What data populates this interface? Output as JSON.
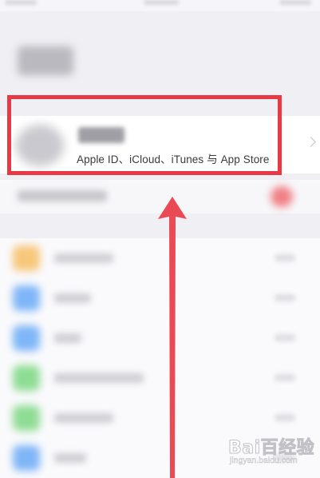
{
  "profile": {
    "subtitle": "Apple ID、iCloud、iTunes 与 App Store"
  },
  "watermark": {
    "logo_text": "Bai百经验",
    "url": "jingyan.baidu.com"
  },
  "colors": {
    "highlight": "#e73a45",
    "arrow": "#e94a53",
    "background": "#efeff4",
    "cell": "#ffffff"
  },
  "icons": {
    "profile_chevron": "chevron-right-icon",
    "avatar": "avatar-icon"
  },
  "settings_rows": [
    {
      "icon_color": "#f7c77b"
    },
    {
      "icon_color": "#7fb6f7"
    },
    {
      "icon_color": "#7fb6f7"
    },
    {
      "icon_color": "#8fdc94"
    },
    {
      "icon_color": "#8fdc94"
    },
    {
      "icon_color": "#7fb6f7"
    }
  ]
}
